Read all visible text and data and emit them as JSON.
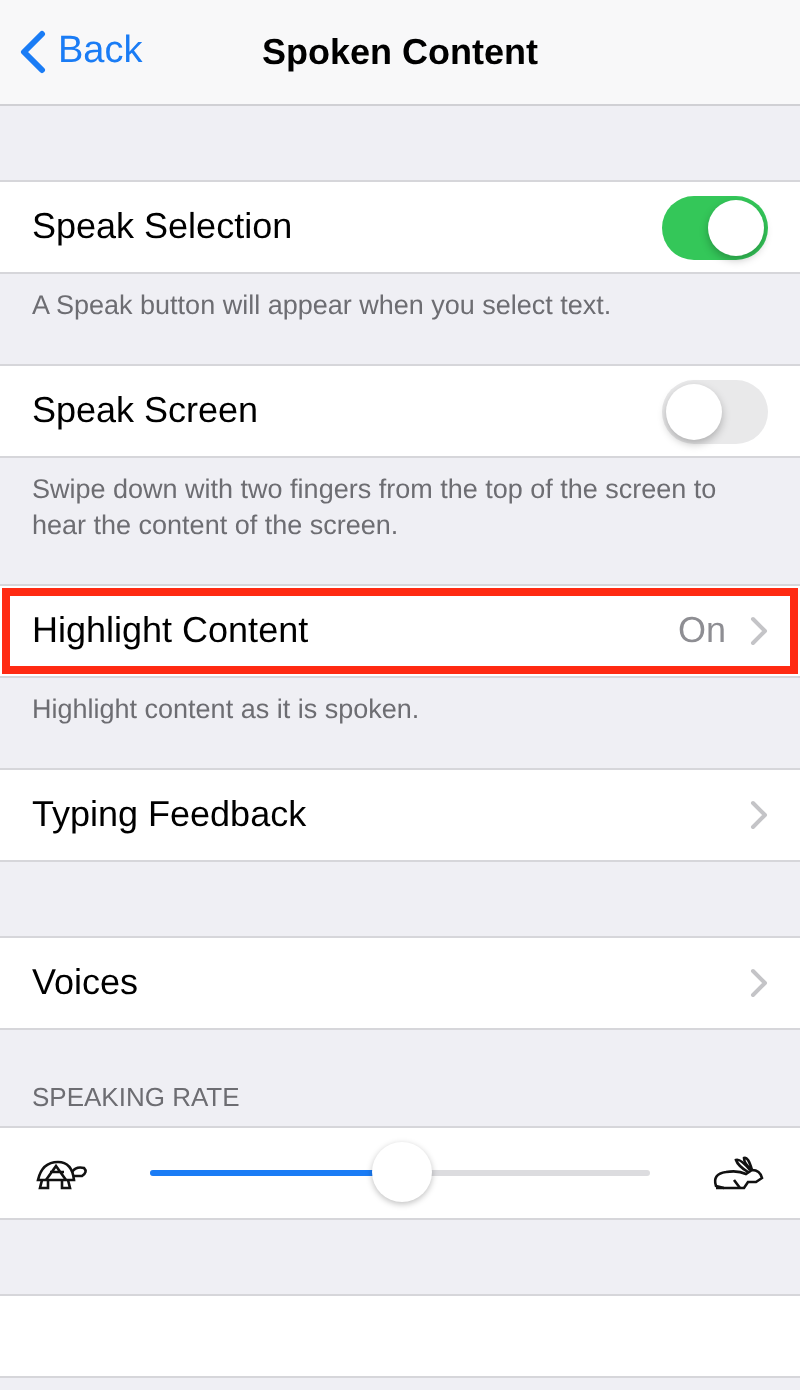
{
  "nav": {
    "back": "Back",
    "title": "Spoken Content"
  },
  "sections": [
    {
      "rows": [
        {
          "kind": "toggle",
          "label": "Speak Selection",
          "on": true
        }
      ],
      "footer": "A Speak button will appear when you select text."
    },
    {
      "rows": [
        {
          "kind": "toggle",
          "label": "Speak Screen",
          "on": false
        }
      ],
      "footer": "Swipe down with two fingers from the top of the screen to hear the content of the screen."
    },
    {
      "rows": [
        {
          "kind": "link",
          "label": "Highlight Content",
          "value": "On",
          "outlined": true
        }
      ],
      "footer": "Highlight content as it is spoken."
    },
    {
      "rows": [
        {
          "kind": "link",
          "label": "Typing Feedback",
          "outlined": false
        }
      ]
    },
    {
      "rows": [
        {
          "kind": "link",
          "label": "Voices",
          "outlined": false
        }
      ]
    },
    {
      "header": "SPEAKING RATE",
      "rows": [
        {
          "kind": "slider",
          "level": 0.505
        }
      ]
    },
    {
      "rows": [
        {
          "kind": "cut"
        }
      ]
    }
  ]
}
